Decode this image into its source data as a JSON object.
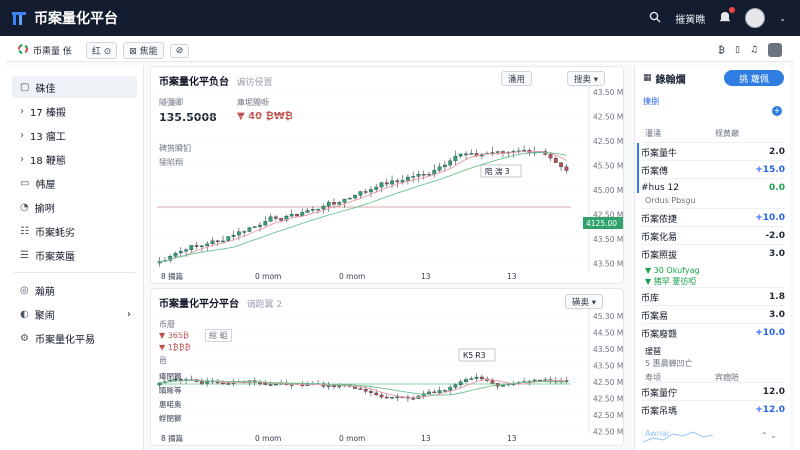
{
  "app": {
    "title": "币案量化平台",
    "user_label": "摧黉瞧"
  },
  "subbar": {
    "crumb": "币熏量 伥",
    "btn1": "红 ⊙",
    "btn2": "⊠ 焦能",
    "btn3": "⊘"
  },
  "sidebar": {
    "items": [
      {
        "label": "硃佳",
        "chev": ""
      },
      {
        "label": "17  榛摋",
        "chev": "›"
      },
      {
        "label": "13  瘤工",
        "chev": "›"
      },
      {
        "label": "18  鞭態",
        "chev": "›"
      },
      {
        "label": "帏屋",
        "chev": ""
      },
      {
        "label": "揄咧",
        "chev": ""
      },
      {
        "label": "币案蚝劣",
        "chev": ""
      },
      {
        "label": "币案萊蜃",
        "chev": ""
      },
      {
        "label": "瀚萠",
        "chev": ""
      },
      {
        "label": "聚闹",
        "chev": "›"
      },
      {
        "label": "币案量化平易",
        "chev": ""
      }
    ]
  },
  "main": {
    "title": "币案量化平负台",
    "subtitle": "谝彷侵置",
    "tab_a": "潘用",
    "tab_b": "搜奥 ▾",
    "stat1_label": "隧彌卿",
    "stat1_value": "135.5008",
    "stat2_label": "庫坭閲呖",
    "stat2_value": "▼ 40 ₿₩₿",
    "leg1": "碑贳瞬钔",
    "leg2": "猛陷翔",
    "tooltip": "陪 湍 3",
    "price_tag": "4125.00",
    "y_ticks": [
      "43.50 M",
      "42.50 M",
      "42.50 M",
      "45.50 M",
      "45.00 M",
      "42.50 M",
      "43.50 M",
      "43.50 M"
    ],
    "x_ticks": [
      "8 摘篇",
      "0 mom",
      "0 mom",
      "13",
      "13"
    ]
  },
  "lower": {
    "title": "币案量化平分平台",
    "subtitle": "谪跑翼 2",
    "btn": "磺奥 ▾",
    "leg1": "币廢",
    "leg2": "▼ 365₿",
    "leg3": "▼ 1₿₿₿",
    "leg4": "邑",
    "tag": "綰 蛆",
    "tooltip": "К5 Ɍ3",
    "y_ticks": [
      "45.30 M",
      "44.50 M",
      "43.50 M",
      "43.50 M",
      "42.50 M",
      "42.50 M",
      "42.50 M",
      "42.50 M"
    ],
    "x_ticks": [
      "8 摘篇",
      "0 mom",
      "0 mom",
      "13",
      "13"
    ],
    "labels": [
      "瘴閉獅",
      "瞋晰等",
      "惠喏奥",
      "蜉閉獅"
    ]
  },
  "right_panel": {
    "title": "錄翰爛",
    "button": "挑 蘿佩",
    "sub": "撲捌",
    "h1": "潘涌",
    "h2": "规黄巅",
    "rows": [
      {
        "name": "币案量牛",
        "value": "2.0",
        "cls": ""
      },
      {
        "name": "币案傅",
        "value": "+15.0",
        "cls": "pos"
      },
      {
        "name": "#hus 12",
        "value": "0.0",
        "cls": "grn"
      },
      {
        "name": "币案侬捷",
        "value": "+10.0",
        "cls": "pos"
      },
      {
        "name": "币案化易",
        "value": "-2.0",
        "cls": ""
      },
      {
        "name": "币案照拔",
        "value": "3.0",
        "cls": ""
      },
      {
        "name": "币库",
        "value": "1.8",
        "cls": ""
      },
      {
        "name": "币案易",
        "value": "3.0",
        "cls": ""
      },
      {
        "name": "币案廢赣",
        "value": "+10.0",
        "cls": "pos"
      },
      {
        "name": "币案量佇",
        "value": "12.0",
        "cls": ""
      },
      {
        "name": "币案吊瑪",
        "value": "+12.0",
        "cls": "pos"
      }
    ],
    "note1": "Ordus Pbsgu",
    "note2": "▼ 30 Okufyag",
    "note3": "▼ 猪罕 蹇彷啞",
    "sec2": "瑷琶",
    "sec2b": "5 惠晨蝉凹亡",
    "h3": "寝撚",
    "h4": "鳐腹鍪",
    "h5": "寿顷",
    "h6": "宾痼陪",
    "footer": "Awnai"
  },
  "colors": {
    "up": "#2fa36b",
    "down": "#c0504d",
    "ma1": "#e89aa0",
    "ma2": "#6bc28f",
    "accent": "#2f7de1"
  }
}
